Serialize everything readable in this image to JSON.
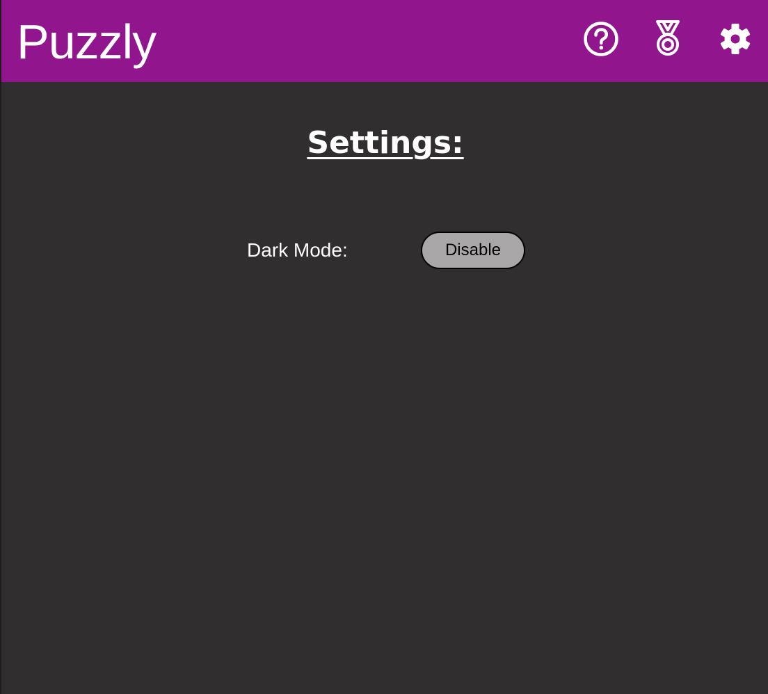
{
  "header": {
    "brand": "Puzzly",
    "icons": {
      "help": "help-circle-icon",
      "stats": "medal-icon",
      "settings": "gear-icon"
    }
  },
  "settings": {
    "title": "Settings:",
    "dark_mode": {
      "label": "Dark Mode:",
      "button_label": "Disable"
    }
  },
  "colors": {
    "header_bg": "#91168d",
    "page_bg": "#302e2f",
    "button_bg": "#a9a7a8",
    "text": "#ffffff"
  }
}
